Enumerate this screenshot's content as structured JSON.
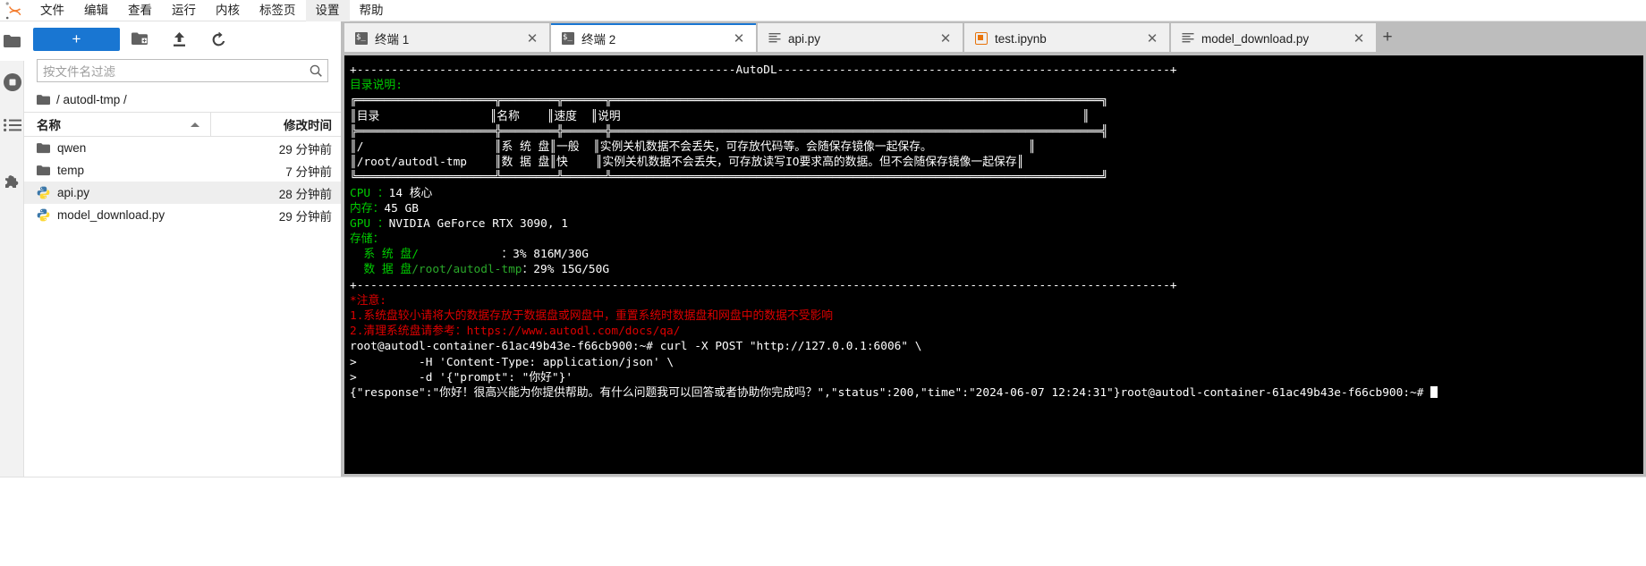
{
  "menu": {
    "logo_name": "jupyter-logo",
    "items": [
      {
        "label": "文件",
        "selected": false
      },
      {
        "label": "编辑",
        "selected": false
      },
      {
        "label": "查看",
        "selected": false
      },
      {
        "label": "运行",
        "selected": false
      },
      {
        "label": "内核",
        "selected": false
      },
      {
        "label": "标签页",
        "selected": false
      },
      {
        "label": "设置",
        "selected": true
      },
      {
        "label": "帮助",
        "selected": false
      }
    ]
  },
  "activitybar": {
    "items": [
      {
        "icon": "folder-icon",
        "name": "file-browser"
      },
      {
        "icon": "running-terminals-icon",
        "name": "running-sessions"
      },
      {
        "icon": "toc-icon",
        "name": "table-of-contents"
      },
      {
        "icon": "puzzle-icon",
        "name": "extension-manager"
      }
    ]
  },
  "filepanel": {
    "new_launcher_label": "+",
    "toolbar": [
      {
        "name": "new-folder-button",
        "icon": "new-folder-icon"
      },
      {
        "name": "upload-button",
        "icon": "upload-icon"
      },
      {
        "name": "refresh-button",
        "icon": "refresh-icon"
      }
    ],
    "filter_placeholder": "按文件名过滤",
    "breadcrumb": "/ autodl-tmp /",
    "columns": {
      "name": "名称",
      "modified": "修改时间"
    },
    "sort": "asc",
    "rows": [
      {
        "name": "qwen",
        "type": "folder",
        "modified": "29 分钟前",
        "selected": false
      },
      {
        "name": "temp",
        "type": "folder",
        "modified": "7 分钟前",
        "selected": false
      },
      {
        "name": "api.py",
        "type": "python",
        "modified": "28 分钟前",
        "selected": true
      },
      {
        "name": "model_download.py",
        "type": "python",
        "modified": "29 分钟前",
        "selected": false
      }
    ]
  },
  "tabs": {
    "add_label": "+",
    "close_label": "✕",
    "items": [
      {
        "label": "终端 1",
        "icon": "terminal-icon",
        "active": false
      },
      {
        "label": "终端 2",
        "icon": "terminal-icon",
        "active": true
      },
      {
        "label": "api.py",
        "icon": "text-file-icon",
        "active": false
      },
      {
        "label": "test.ipynb",
        "icon": "notebook-icon",
        "active": false
      },
      {
        "label": "model_download.py",
        "icon": "text-file-icon",
        "active": false
      }
    ]
  },
  "terminal": {
    "lines": [
      {
        "segments": [
          {
            "t": "+-------------------------------------------------------AutoDL---------------------------------------------------------+",
            "c": "w"
          }
        ]
      },
      {
        "segments": [
          {
            "t": "目录说明:",
            "c": "g"
          }
        ]
      },
      {
        "segments": [
          {
            "t": "╔════════════════════╦════════╦══════╦═══════════════════════════════════════════════════════════════════════╗",
            "c": "w"
          }
        ]
      },
      {
        "segments": [
          {
            "t": "║目录                ║名称    ║速度  ║说明                                                                   ║",
            "c": "w"
          }
        ]
      },
      {
        "segments": [
          {
            "t": "╠════════════════════╬════════╬══════╬═══════════════════════════════════════════════════════════════════════╣",
            "c": "w"
          }
        ]
      },
      {
        "segments": [
          {
            "t": "║/                   ║系 统 盘║一般  ║实例关机数据不会丢失，可存放代码等。会随保存镜像一起保存。              ║",
            "c": "w"
          }
        ]
      },
      {
        "segments": [
          {
            "t": "║/root/autodl-tmp    ║数 据 盘║快    ║实例关机数据不会丢失，可存放读写IO要求高的数据。但不会随保存镜像一起保存║",
            "c": "w"
          }
        ]
      },
      {
        "segments": [
          {
            "t": "╚════════════════════╩════════╩══════╩═══════════════════════════════════════════════════════════════════════╝",
            "c": "w"
          }
        ]
      },
      {
        "segments": [
          {
            "t": "CPU ：",
            "c": "g"
          },
          {
            "t": "14 核心",
            "c": "w"
          }
        ]
      },
      {
        "segments": [
          {
            "t": "内存：",
            "c": "g"
          },
          {
            "t": "45 GB",
            "c": "w"
          }
        ]
      },
      {
        "segments": [
          {
            "t": "GPU ：",
            "c": "g"
          },
          {
            "t": "NVIDIA GeForce RTX 3090, 1",
            "c": "w"
          }
        ]
      },
      {
        "segments": [
          {
            "t": "存储：",
            "c": "g"
          }
        ]
      },
      {
        "segments": [
          {
            "t": "  系 统 盘/",
            "c": "g"
          },
          {
            "t": "            ",
            "c": "w"
          },
          {
            "t": "：3% 816M/30G",
            "c": "w"
          }
        ]
      },
      {
        "segments": [
          {
            "t": "  数 据 盘",
            "c": "g"
          },
          {
            "t": "/root/autodl-tmp",
            "c": "gdim"
          },
          {
            "t": "：29% 15G/50G",
            "c": "w"
          }
        ]
      },
      {
        "segments": [
          {
            "t": "+----------------------------------------------------------------------------------------------------------------------+",
            "c": "w"
          }
        ]
      },
      {
        "segments": [
          {
            "t": "*注意:",
            "c": "r"
          }
        ]
      },
      {
        "segments": [
          {
            "t": "1.系统盘较小请将大的数据存放于数据盘或网盘中，重置系统时数据盘和网盘中的数据不受影响",
            "c": "r"
          }
        ]
      },
      {
        "segments": [
          {
            "t": "2.清理系统盘请参考：",
            "c": "r"
          },
          {
            "t": "https://www.autodl.com/docs/qa/",
            "c": "r"
          }
        ]
      },
      {
        "segments": [
          {
            "t": "root@autodl-container-61ac49b43e-f66cb900:~# curl -X POST \"http://127.0.0.1:6006\" \\",
            "c": "w"
          }
        ]
      },
      {
        "segments": [
          {
            "t": ">         -H 'Content-Type: application/json' \\",
            "c": "w"
          }
        ]
      },
      {
        "segments": [
          {
            "t": ">         -d '{\"prompt\": \"你好\"}'",
            "c": "w"
          }
        ]
      },
      {
        "segments": [
          {
            "t": "{\"response\":\"你好！很高兴能为你提供帮助。有什么问题我可以回答或者协助你完成吗？\",\"status\":200,\"time\":\"2024-06-07 12:24:31\"}root@autodl-container-61ac49b43e-f66cb900:~# ",
            "c": "w"
          }
        ]
      }
    ],
    "prompt_cursor": "█"
  }
}
